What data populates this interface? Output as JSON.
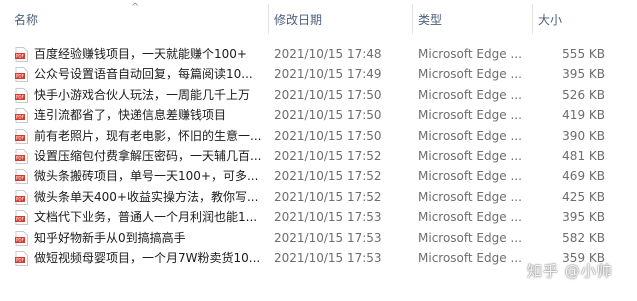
{
  "columns": {
    "name": "名称",
    "date": "修改日期",
    "type": "类型",
    "size": "大小"
  },
  "sort": {
    "column": "name",
    "icon": "chevron-up-icon"
  },
  "file_icon": "pdf-file-icon",
  "files": [
    {
      "name": "百度经验赚钱项目，一天就能赚个100+",
      "date": "2021/10/15 17:48",
      "type": "Microsoft Edge ...",
      "size": "555 KB"
    },
    {
      "name": "公众号设置语音自动回复，每篇阅读10...",
      "date": "2021/10/15 17:49",
      "type": "Microsoft Edge ...",
      "size": "395 KB"
    },
    {
      "name": "快手小游戏合伙人玩法，一周能几千上万",
      "date": "2021/10/15 17:50",
      "type": "Microsoft Edge ...",
      "size": "526 KB"
    },
    {
      "name": "连引流都省了，快递信息差赚钱项目",
      "date": "2021/10/15 17:50",
      "type": "Microsoft Edge ...",
      "size": "419 KB"
    },
    {
      "name": "前有老照片，现有老电影，怀旧的生意一...",
      "date": "2021/10/15 17:50",
      "type": "Microsoft Edge ...",
      "size": "390 KB"
    },
    {
      "name": "设置压缩包付费拿解压密码，一天辅几百...",
      "date": "2021/10/15 17:52",
      "type": "Microsoft Edge ...",
      "size": "481 KB"
    },
    {
      "name": "微头条搬砖项目，单号一天100+，可多...",
      "date": "2021/10/15 17:52",
      "type": "Microsoft Edge ...",
      "size": "469 KB"
    },
    {
      "name": "微头条单天400+收益实操方法，教你写...",
      "date": "2021/10/15 17:52",
      "type": "Microsoft Edge ...",
      "size": "425 KB"
    },
    {
      "name": "文档代下业务，普通人一个月利润也能1...",
      "date": "2021/10/15 17:53",
      "type": "Microsoft Edge ...",
      "size": "395 KB"
    },
    {
      "name": "知乎好物新手从0到搞搞高手",
      "date": "2021/10/15 17:53",
      "type": "Microsoft Edge ...",
      "size": "582 KB"
    },
    {
      "name": "做短视频母婴项目，一个月7W粉卖货10...",
      "date": "2021/10/15 17:53",
      "type": "Microsoft Edge ...",
      "size": "359 KB"
    }
  ],
  "watermark": "知乎 @小帅",
  "colors": {
    "header_text": "#4c607a",
    "secondary_text": "#6d6d6d",
    "pdf_red": "#d63b2f"
  }
}
